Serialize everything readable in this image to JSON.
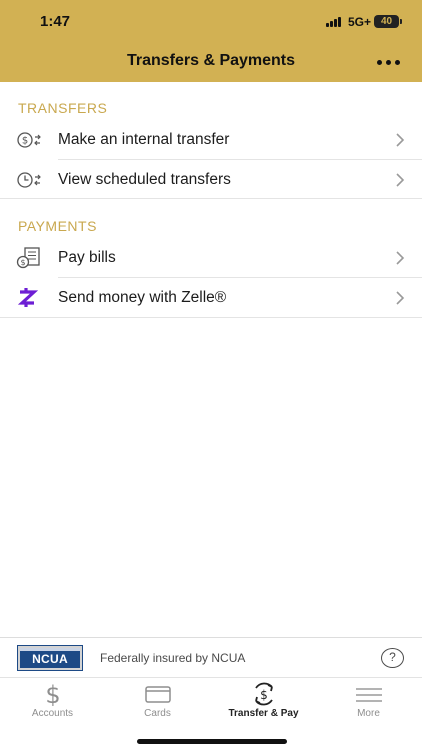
{
  "status_bar": {
    "time": "1:47",
    "network": "5G+",
    "battery": "40"
  },
  "header": {
    "title": "Transfers & Payments",
    "more_icon": "more-horizontal-icon",
    "background": "#d2b153"
  },
  "sections": {
    "transfers": {
      "title": "TRANSFERS",
      "items": [
        {
          "label": "Make an internal transfer",
          "icon": "dollar-transfer-icon"
        },
        {
          "label": "View scheduled transfers",
          "icon": "clock-transfer-icon"
        }
      ]
    },
    "payments": {
      "title": "PAYMENTS",
      "items": [
        {
          "label": "Pay bills",
          "icon": "bill-icon"
        },
        {
          "label": "Send money with Zelle®",
          "icon": "zelle-icon"
        }
      ]
    }
  },
  "footer": {
    "logo_text": "NCUA",
    "insured_text": "Federally insured by NCUA",
    "help_label": "?"
  },
  "tabs": [
    {
      "label": "Accounts",
      "icon": "dollar-icon",
      "active": false
    },
    {
      "label": "Cards",
      "icon": "card-icon",
      "active": false
    },
    {
      "label": "Transfer & Pay",
      "icon": "transfer-pay-icon",
      "active": true
    },
    {
      "label": "More",
      "icon": "menu-icon",
      "active": false
    }
  ],
  "colors": {
    "accent": "#d2b153",
    "section_title": "#c9a84f",
    "zelle": "#6d1ed4"
  }
}
